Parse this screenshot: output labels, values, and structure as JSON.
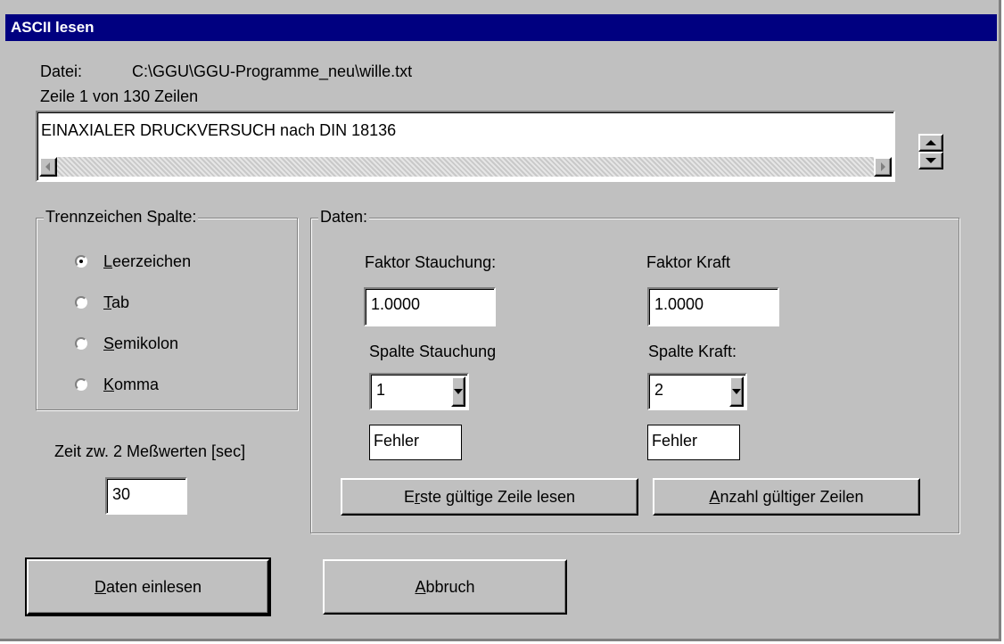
{
  "window": {
    "title": "ASCII lesen"
  },
  "file": {
    "label": "Datei:",
    "path": "C:\\GGU\\GGU-Programme_neu\\wille.txt"
  },
  "line_info": "Zeile 1 von 130 Zeilen",
  "preview": {
    "text": "EINAXIALER DRUCKVERSUCH nach DIN 18136"
  },
  "separator_group": {
    "title": "Trennzeichen Spalte:",
    "options": [
      {
        "mnemonic": "L",
        "rest": "eerzeichen",
        "selected": true
      },
      {
        "mnemonic": "T",
        "rest": "ab",
        "selected": false
      },
      {
        "mnemonic": "S",
        "rest": "emikolon",
        "selected": false
      },
      {
        "mnemonic": "K",
        "rest": "omma",
        "selected": false
      }
    ]
  },
  "time": {
    "label": "Zeit zw. 2 Meßwerten [sec]",
    "value": "30"
  },
  "data_group": {
    "title": "Daten:",
    "factor_compression_label": "Faktor Stauchung:",
    "factor_compression_value": "1.0000",
    "factor_force_label": "Faktor Kraft",
    "factor_force_value": "1.0000",
    "column_compression_label": "Spalte Stauchung",
    "column_compression_value": "1",
    "column_force_label": "Spalte Kraft:",
    "column_force_value": "2",
    "error_compression": "Fehler",
    "error_force": "Fehler",
    "read_first_button": {
      "pre": "E",
      "mnemonic": "r",
      "rest": "ste gültige Zeile lesen"
    },
    "count_lines_button": {
      "mnemonic": "A",
      "rest": "nzahl gültiger Zeilen"
    }
  },
  "buttons": {
    "read_data": {
      "mnemonic": "D",
      "rest": "aten einlesen"
    },
    "cancel": {
      "mnemonic": "A",
      "rest": "bbruch"
    }
  },
  "colors": {
    "titlebar": "#000080",
    "face": "#c0c0c0",
    "shadow": "#808080",
    "highlight": "#ffffff"
  }
}
